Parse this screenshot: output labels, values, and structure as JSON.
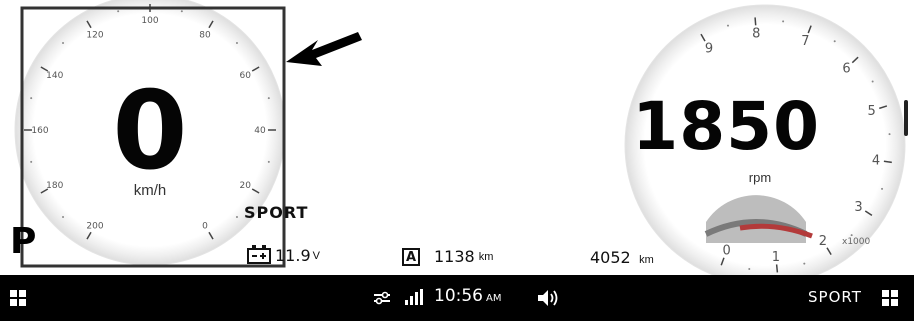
{
  "speedometer": {
    "speed": "0",
    "unit": "km/h",
    "tick_labels": [
      "0",
      "20",
      "40",
      "60",
      "80",
      "100",
      "120",
      "140",
      "160",
      "180",
      "200"
    ]
  },
  "tachometer": {
    "rpm": "1850",
    "unit": "rpm",
    "multiplier": "x1000",
    "tick_labels": [
      "0",
      "1",
      "2",
      "3",
      "4",
      "5",
      "6",
      "7",
      "8",
      "9"
    ]
  },
  "drive_mode": "SPORT",
  "gear": "P",
  "battery": {
    "value": "11.9",
    "unit": "V"
  },
  "trip": {
    "label": "A",
    "value": "1138",
    "unit": "km"
  },
  "odometer": {
    "value": "4052",
    "unit": "km"
  },
  "status_bar": {
    "time": "10:56",
    "ampm": "AM",
    "mode": "SPORT",
    "icons": [
      "apps-grid-icon",
      "settings-sliders-icon",
      "signal-icon",
      "volume-icon",
      "apps-grid-icon"
    ]
  },
  "annotation": {
    "box_color": "#333333",
    "arrow_color": "#000000"
  },
  "colors": {
    "rpm_zone_fill": "#bdbdbd",
    "rpm_zone_arc": "#7a7a7a",
    "rpm_red_arc": "#b33a3a"
  }
}
